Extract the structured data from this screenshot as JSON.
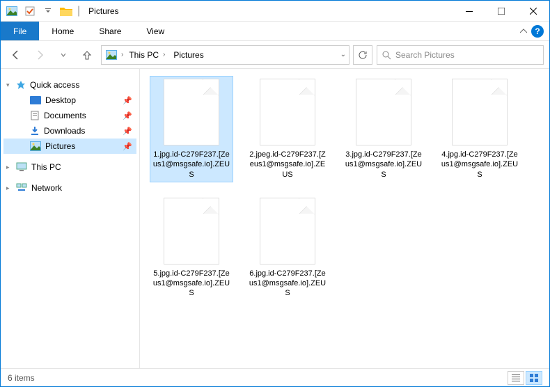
{
  "title": "Pictures",
  "ribbon": {
    "file": "File",
    "home": "Home",
    "share": "Share",
    "view": "View"
  },
  "breadcrumb": {
    "root": "This PC",
    "folder": "Pictures"
  },
  "search_placeholder": "Search Pictures",
  "nav": {
    "quick": "Quick access",
    "desktop": "Desktop",
    "documents": "Documents",
    "downloads": "Downloads",
    "pictures": "Pictures",
    "thispc": "This PC",
    "network": "Network"
  },
  "files": [
    "1.jpg.id-C279F237.[Zeus1@msgsafe.io].ZEUS",
    "2.jpeg.id-C279F237.[Zeus1@msgsafe.io].ZEUS",
    "3.jpg.id-C279F237.[Zeus1@msgsafe.io].ZEUS",
    "4.jpg.id-C279F237.[Zeus1@msgsafe.io].ZEUS",
    "5.jpg.id-C279F237.[Zeus1@msgsafe.io].ZEUS",
    "6.jpg.id-C279F237.[Zeus1@msgsafe.io].ZEUS"
  ],
  "status": "6 items"
}
